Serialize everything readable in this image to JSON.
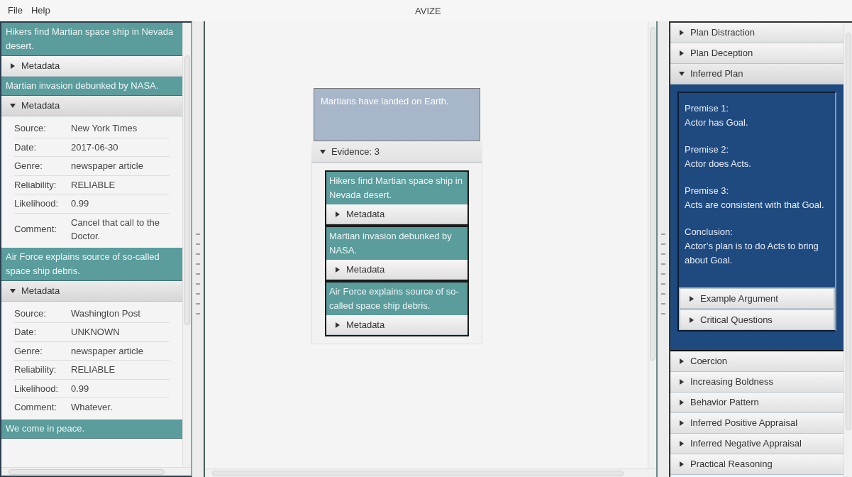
{
  "menu": [
    "File",
    "Help"
  ],
  "window": {
    "title": "AVIZE"
  },
  "evidence_list": [
    {
      "headline": "Hikers find Martian space ship in Nevada desert.",
      "metadata": {
        "label": "Metadata",
        "expanded": false
      }
    },
    {
      "headline": "Martian invasion debunked by NASA.",
      "metadata": {
        "label": "Metadata",
        "expanded": true,
        "fields": [
          {
            "label": "Source:",
            "value": "New York Times"
          },
          {
            "label": "Date:",
            "value": "2017-06-30"
          },
          {
            "label": "Genre:",
            "value": "newspaper article"
          },
          {
            "label": "Reliability:",
            "value": "RELIABLE"
          },
          {
            "label": "Likelihood:",
            "value": "0.99"
          },
          {
            "label": "Comment:",
            "value": "Cancel that call to the Doctor."
          }
        ]
      }
    },
    {
      "headline": "Air Force explains source of so-called space ship debris.",
      "metadata": {
        "label": "Metadata",
        "expanded": true,
        "fields": [
          {
            "label": "Source:",
            "value": "Washington Post"
          },
          {
            "label": "Date:",
            "value": "UNKNOWN"
          },
          {
            "label": "Genre:",
            "value": "newspaper article"
          },
          {
            "label": "Reliability:",
            "value": "RELIABLE"
          },
          {
            "label": "Likelihood:",
            "value": "0.99"
          },
          {
            "label": "Comment:",
            "value": "Whatever."
          }
        ]
      }
    },
    {
      "headline": "We come in peace."
    }
  ],
  "canvas": {
    "claim": "Martians have landed on Earth.",
    "evidence": {
      "label": "Evidence: 3",
      "expanded": true,
      "items": [
        {
          "headline": "Hikers find Martian space ship in Nevada desert.",
          "metadata": {
            "label": "Metadata",
            "expanded": false
          }
        },
        {
          "headline": "Martian invasion debunked by NASA.",
          "metadata": {
            "label": "Metadata",
            "expanded": false
          }
        },
        {
          "headline": "Air Force explains source of so-called space ship debris.",
          "metadata": {
            "label": "Metadata",
            "expanded": false
          }
        }
      ]
    }
  },
  "schemes": [
    {
      "label": "Plan Distraction",
      "expanded": false
    },
    {
      "label": "Plan Deception",
      "expanded": false
    },
    {
      "label": "Inferred Plan",
      "expanded": true,
      "body": [
        {
          "heading": "Premise 1:",
          "text": "Actor has Goal."
        },
        {
          "heading": "Premise 2:",
          "text": "Actor does Acts."
        },
        {
          "heading": "Premise 3:",
          "text": "Acts are consistent with that Goal."
        },
        {
          "heading": "Conclusion:",
          "text": "Actor’s plan is to do Acts to bring about Goal."
        }
      ],
      "sections": [
        {
          "label": "Example Argument",
          "expanded": false
        },
        {
          "label": "Critical Questions",
          "expanded": false
        }
      ]
    },
    {
      "label": "Coercion",
      "expanded": false
    },
    {
      "label": "Increasing Boldness",
      "expanded": false
    },
    {
      "label": "Behavior Pattern",
      "expanded": false
    },
    {
      "label": "Inferred Positive Appraisal",
      "expanded": false
    },
    {
      "label": "Inferred Negative Appraisal",
      "expanded": false
    },
    {
      "label": "Practical Reasoning",
      "expanded": false
    }
  ]
}
